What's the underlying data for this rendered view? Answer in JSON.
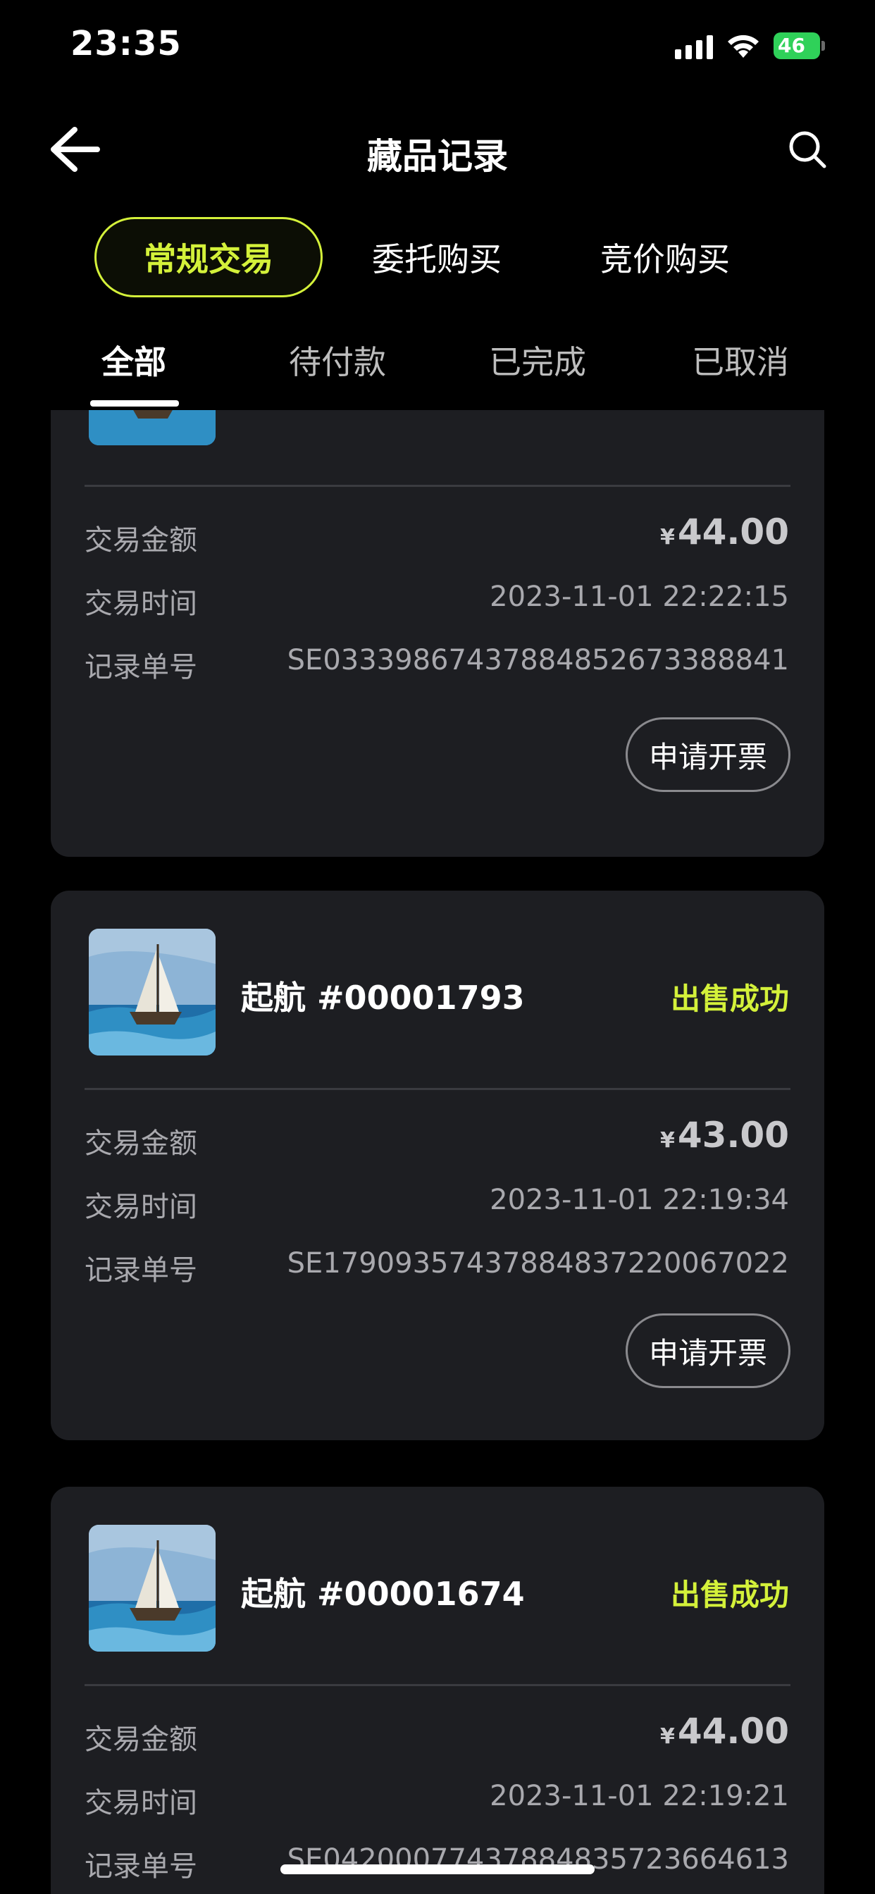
{
  "status_bar": {
    "time": "23:35",
    "battery": "46"
  },
  "header": {
    "title": "藏品记录"
  },
  "type_tabs": [
    {
      "label": "常规交易",
      "active": true
    },
    {
      "label": "委托购买",
      "active": false
    },
    {
      "label": "竞价购买",
      "active": false
    }
  ],
  "status_tabs": [
    {
      "label": "全部",
      "active": true
    },
    {
      "label": "待付款",
      "active": false
    },
    {
      "label": "已完成",
      "active": false
    },
    {
      "label": "已取消",
      "active": false
    }
  ],
  "field_labels": {
    "amount": "交易金额",
    "time": "交易时间",
    "record_no": "记录单号"
  },
  "currency": "¥",
  "invoice_label": "申请开票",
  "records": [
    {
      "name": "",
      "status": "",
      "amount": "44.00",
      "time": "2023-11-01 22:22:15",
      "record_no": "SE033398674378848526733888 41"
    },
    {
      "name": "起航 #00001793",
      "status": "出售成功",
      "amount": "43.00",
      "time": "2023-11-01 22:19:34",
      "record_no": "SE179093574378848372200670 22"
    },
    {
      "name": "起航 #00001674",
      "status": "出售成功",
      "amount": "44.00",
      "time": "2023-11-01 22:19:21",
      "record_no": "SE042000774378848357236646 13"
    }
  ],
  "colors": {
    "accent": "#d4f13a",
    "card": "#1d1e22",
    "background": "#000000"
  },
  "icons": {
    "back": "arrow-left-icon",
    "search": "search-icon"
  }
}
